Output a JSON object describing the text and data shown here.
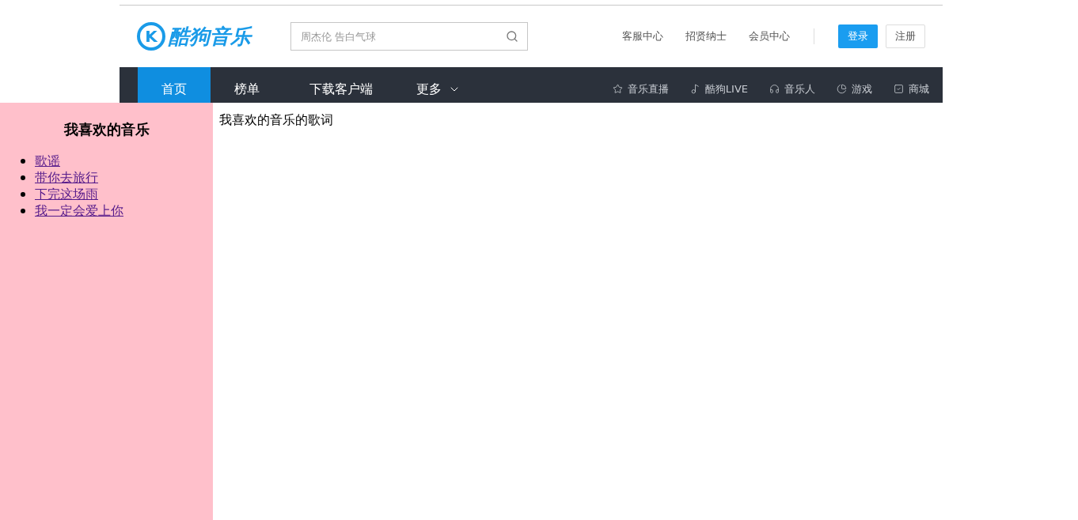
{
  "logo": {
    "mark": "K",
    "text": "酷狗音乐"
  },
  "search": {
    "placeholder": "周杰伦 告白气球"
  },
  "top_links": [
    "客服中心",
    "招贤纳士",
    "会员中心"
  ],
  "buttons": {
    "login": "登录",
    "register": "注册"
  },
  "nav_tabs": [
    {
      "label": "首页",
      "selected": true,
      "dropdown": false
    },
    {
      "label": "榜单",
      "selected": false,
      "dropdown": false
    },
    {
      "label": "下载客户端",
      "selected": false,
      "dropdown": false
    },
    {
      "label": "更多",
      "selected": false,
      "dropdown": true
    }
  ],
  "nav_links": [
    "音乐直播",
    "酷狗LIVE",
    "音乐人",
    "游戏",
    "商城"
  ],
  "sidebar": {
    "title": "我喜欢的音乐",
    "songs": [
      "歌谣",
      "带你去旅行",
      "下完这场雨",
      "我一定会爱上你"
    ]
  },
  "main": {
    "text": "我喜欢的音乐的歌词"
  }
}
